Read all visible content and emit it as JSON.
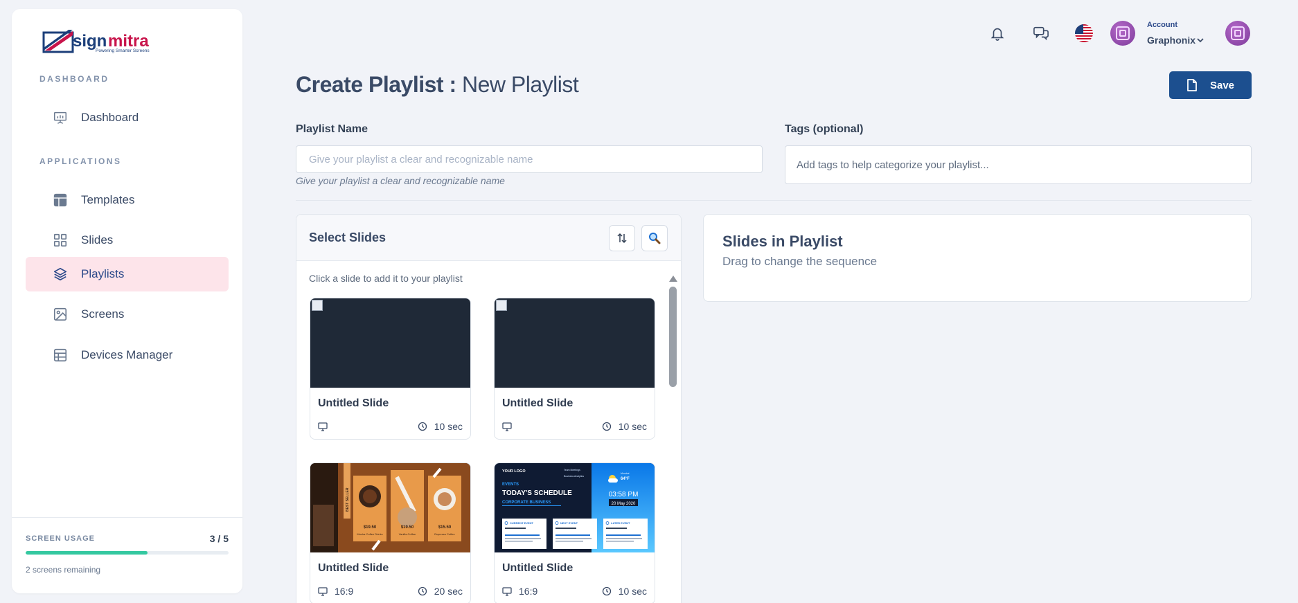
{
  "brand": {
    "name_part1": "sign",
    "name_part2": "mitra",
    "tagline": "Powering Smarter Screens"
  },
  "sidebar": {
    "dashboard_section": "DASHBOARD",
    "applications_section": "APPLICATIONS",
    "items": [
      {
        "label": "Dashboard",
        "icon": "presentation-chart-icon"
      },
      {
        "label": "Templates",
        "icon": "layout-template-icon"
      },
      {
        "label": "Slides",
        "icon": "grid-icon"
      },
      {
        "label": "Playlists",
        "icon": "layers-icon",
        "active": true
      },
      {
        "label": "Screens",
        "icon": "image-icon"
      },
      {
        "label": "Devices Manager",
        "icon": "table-icon"
      }
    ],
    "usage": {
      "label": "SCREEN USAGE",
      "count": "3 / 5",
      "fraction": 0.6,
      "remaining": "2 screens remaining"
    }
  },
  "topbar": {
    "account_label": "Account",
    "account_name": "Graphonix"
  },
  "header": {
    "title_strong": "Create Playlist :",
    "title_light": "New Playlist",
    "save_label": "Save"
  },
  "form": {
    "name_label": "Playlist Name",
    "name_placeholder": "Give your playlist a clear and recognizable name",
    "name_hint": "Give your playlist a clear and recognizable name",
    "tags_label": "Tags (optional)",
    "tags_placeholder": "Add tags to help categorize your playlist..."
  },
  "select_slides": {
    "title": "Select Slides",
    "instruction": "Click a slide to add it to your playlist",
    "slides": [
      {
        "title": "Untitled Slide",
        "ratio": "",
        "duration": "10 sec",
        "thumb": "broken"
      },
      {
        "title": "Untitled Slide",
        "ratio": "",
        "duration": "10 sec",
        "thumb": "broken"
      },
      {
        "title": "Untitled Slide",
        "ratio": "16:9",
        "duration": "20 sec",
        "thumb": "coffee-menu"
      },
      {
        "title": "Untitled Slide",
        "ratio": "16:9",
        "duration": "10 sec",
        "thumb": "event-schedule"
      }
    ]
  },
  "coffee_thumb": {
    "label": "BEST SELLER",
    "prices": [
      "$19.50",
      "$19.50",
      "$15.50"
    ],
    "names": [
      "Mocha Coffee Drinks",
      "Vanilla Coffee",
      "Espresso Coffee"
    ]
  },
  "schedule_thumb": {
    "logo": "YOUR LOGO",
    "checks": [
      "Team Meetings",
      "Business Analytics"
    ],
    "kicker": "EVENTS",
    "title": "TODAY'S SCHEDULE",
    "subtitle": "CORPORATE BUSINESS",
    "weather": "64°F",
    "weather_city": "Mumbai",
    "time": "03:58 PM",
    "date": "20 May 2020",
    "events": [
      "CURRENT EVENT",
      "NEXT EVENT",
      "LATER EVENT"
    ]
  },
  "playlist": {
    "title": "Slides in Playlist",
    "subtitle": "Drag to change the sequence"
  },
  "colors": {
    "primary": "#1c4f8f",
    "active_bg": "#fde4ea",
    "usage_fill": "#34c8a0",
    "brand_red": "#c8144b"
  }
}
